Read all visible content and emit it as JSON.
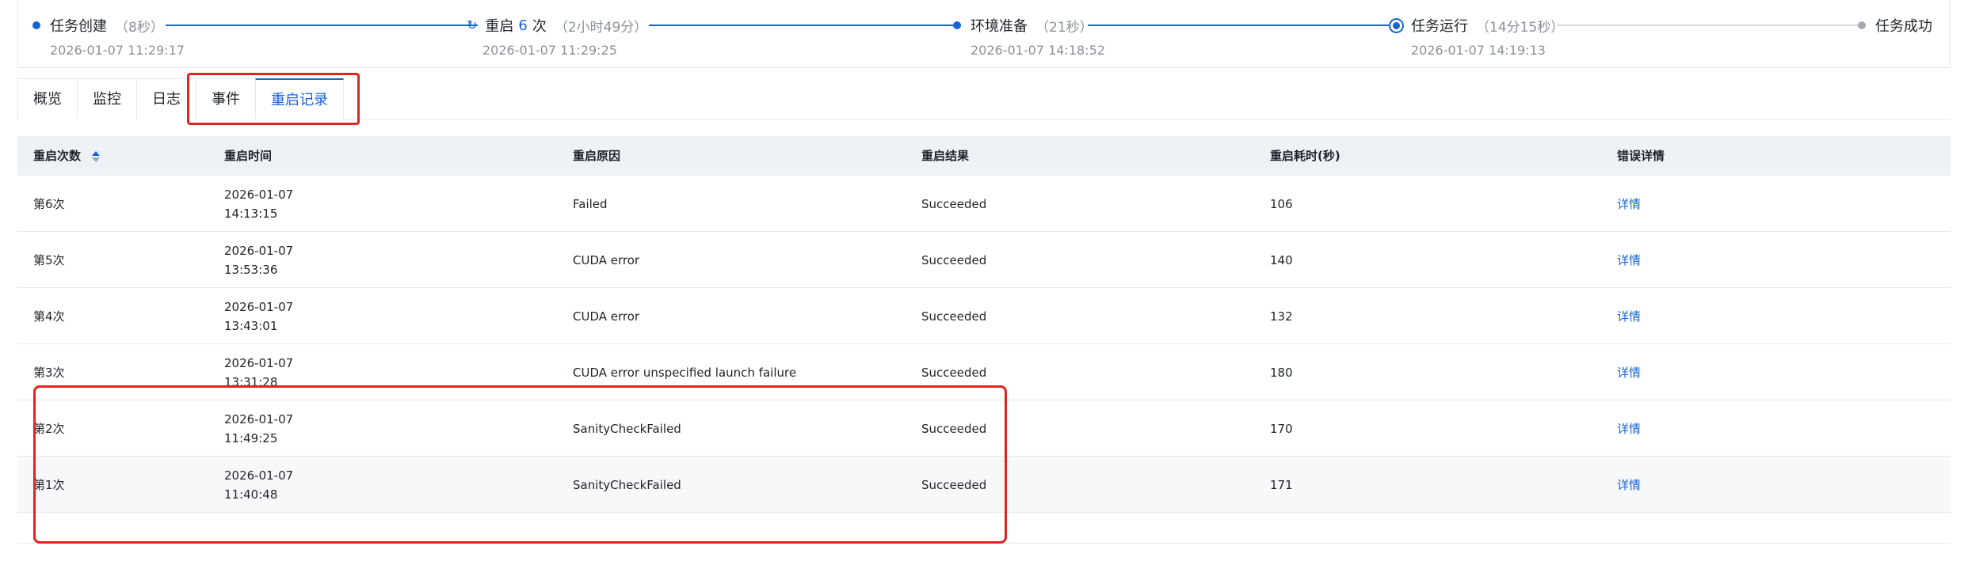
{
  "timeline": {
    "steps": [
      {
        "name": "任务创建",
        "duration": "（8秒）",
        "time": "2026-01-07 11:29:17"
      },
      {
        "name": "重启",
        "count": "6",
        "unit": "次",
        "duration": "（2小时49分）",
        "time": "2026-01-07 11:29:25"
      },
      {
        "name": "环境准备",
        "duration": "（21秒）",
        "time": "2026-01-07 14:18:52"
      },
      {
        "name": "任务运行",
        "duration": "（14分15秒）",
        "time": "2026-01-07 14:19:13"
      },
      {
        "name": "任务成功"
      }
    ],
    "colors": {
      "done": "#1664d9",
      "pending": "#a3a9b1"
    }
  },
  "tabs": [
    "概览",
    "监控",
    "日志",
    "事件",
    "重启记录"
  ],
  "active_tab": "重启记录",
  "table": {
    "headers": [
      "重启次数",
      "重启时间",
      "重启原因",
      "重启结果",
      "重启耗时(秒)",
      "错误详情"
    ],
    "rows": [
      {
        "count": "第6次",
        "date": "2026-01-07",
        "clock": "14:13:15",
        "reason": "Failed",
        "result": "Succeeded",
        "duration": "106",
        "detail": "详情"
      },
      {
        "count": "第5次",
        "date": "2026-01-07",
        "clock": "13:53:36",
        "reason": "CUDA error",
        "result": "Succeeded",
        "duration": "140",
        "detail": "详情"
      },
      {
        "count": "第4次",
        "date": "2026-01-07",
        "clock": "13:43:01",
        "reason": "CUDA error",
        "result": "Succeeded",
        "duration": "132",
        "detail": "详情"
      },
      {
        "count": "第3次",
        "date": "2026-01-07",
        "clock": "13:31:28",
        "reason": "CUDA error unspecified launch failure",
        "result": "Succeeded",
        "duration": "180",
        "detail": "详情"
      },
      {
        "count": "第2次",
        "date": "2026-01-07",
        "clock": "11:49:25",
        "reason": "SanityCheckFailed",
        "result": "Succeeded",
        "duration": "170",
        "detail": "详情"
      },
      {
        "count": "第1次",
        "date": "2026-01-07",
        "clock": "11:40:48",
        "reason": "SanityCheckFailed",
        "result": "Succeeded",
        "duration": "171",
        "detail": "详情"
      }
    ]
  },
  "colors": {
    "accent": "#1664d9",
    "highlight": "#e3231c",
    "header_bg": "#eef1f6"
  }
}
